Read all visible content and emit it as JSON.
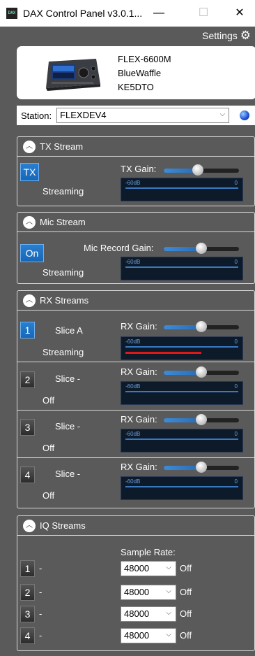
{
  "window": {
    "title": "DAX Control Panel v3.0.1...",
    "icon_text": "DAX",
    "minimize": "—",
    "maximize": "☐",
    "close": "✕"
  },
  "settings": {
    "label": "Settings",
    "icon": "gear-icon"
  },
  "radio": {
    "model": "FLEX-6600M",
    "nickname": "BlueWaffle",
    "callsign": "KE5DTO"
  },
  "station": {
    "label": "Station:",
    "value": "FLEXDEV4"
  },
  "tx_stream": {
    "header": "TX Stream",
    "button": "TX",
    "status": "Streaming",
    "gain_label": "TX Gain:",
    "gain_level": 0.45,
    "meter_lo": "-60dB",
    "meter_hi": "0"
  },
  "mic_stream": {
    "header": "Mic Stream",
    "button": "On",
    "status": "Streaming",
    "gain_label": "Mic Record Gain:",
    "gain_level": 0.5,
    "meter_lo": "-60dB",
    "meter_hi": "0"
  },
  "rx_streams": {
    "header": "RX Streams",
    "items": [
      {
        "num": "1",
        "slice": "Slice A",
        "status": "Streaming",
        "gain_label": "RX Gain:",
        "gain_level": 0.5,
        "meter_lo": "-60dB",
        "meter_hi": "0",
        "active": true,
        "level": 0.67
      },
      {
        "num": "2",
        "slice": "Slice -",
        "status": "Off",
        "gain_label": "RX Gain:",
        "gain_level": 0.5,
        "meter_lo": "-60dB",
        "meter_hi": "0",
        "active": false,
        "level": 0
      },
      {
        "num": "3",
        "slice": "Slice -",
        "status": "Off",
        "gain_label": "RX Gain:",
        "gain_level": 0.5,
        "meter_lo": "-60dB",
        "meter_hi": "0",
        "active": false,
        "level": 0
      },
      {
        "num": "4",
        "slice": "Slice -",
        "status": "Off",
        "gain_label": "RX Gain:",
        "gain_level": 0.5,
        "meter_lo": "-60dB",
        "meter_hi": "0",
        "active": false,
        "level": 0
      }
    ]
  },
  "iq_streams": {
    "header": "IQ Streams",
    "sample_rate_label": "Sample Rate:",
    "items": [
      {
        "num": "1",
        "freq": "-",
        "rate": "48000",
        "status": "Off"
      },
      {
        "num": "2",
        "freq": "-",
        "rate": "48000",
        "status": "Off"
      },
      {
        "num": "3",
        "freq": "-",
        "rate": "48000",
        "status": "Off"
      },
      {
        "num": "4",
        "freq": "-",
        "rate": "48000",
        "status": "Off"
      }
    ]
  },
  "colors": {
    "panel_bg": "#5a5a5a",
    "accent_blue": "#1e74c8",
    "meter_bg": "#0d1a2a",
    "level_red": "#e01818"
  }
}
